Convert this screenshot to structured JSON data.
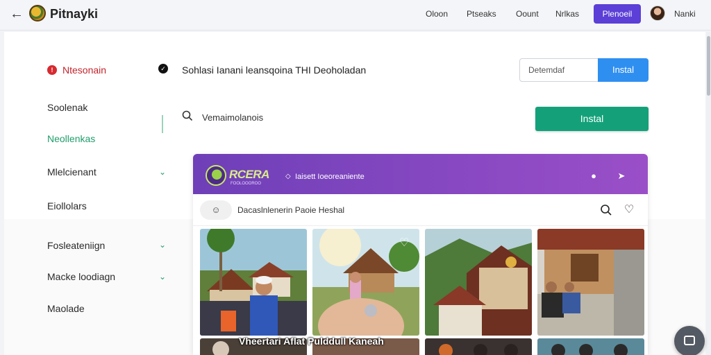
{
  "header": {
    "back_icon": "arrow-left-icon",
    "app_title": "Pitnayki",
    "nav": [
      "Oloon",
      "Ptseaks",
      "Oount",
      "Nrlkas"
    ],
    "primary_button": "Plenoeil",
    "user_name": "Nanki",
    "accent_color": "#5b3fd6"
  },
  "sidebar": {
    "items": [
      {
        "label": "Ntesonain",
        "state": "alert"
      },
      {
        "label": "Soolenak",
        "state": "normal"
      },
      {
        "label": "Neollenkas",
        "state": "active"
      },
      {
        "label": "Mlelcienant",
        "state": "collapsible"
      },
      {
        "label": "Eiollolars",
        "state": "normal"
      },
      {
        "label": "Fosleateniign",
        "state": "collapsible"
      },
      {
        "label": "Macke loodiagn",
        "state": "collapsible"
      },
      {
        "label": "Maolade",
        "state": "normal"
      }
    ],
    "active_color": "#1f9d6b",
    "alert_color": "#c0242c"
  },
  "content": {
    "headline": "Sohlasi Ianani leansqoina THI Deoholadan",
    "search_label": "Vemaimolanois",
    "field_value": "Detemdaf",
    "field_button": "Instal",
    "install_button": "Instal"
  },
  "panel": {
    "brand": "RCERA",
    "brand_sub": "FOOLOOOROO",
    "tag": "Iaisett Ioeoreaniente",
    "subtitle": "Dacaslnlenerin Paoie Heshal",
    "caption": "Vheertari Aflat Pulddull Kaneah",
    "header_colors": [
      "#6e3fb8",
      "#9a4fc8"
    ]
  }
}
